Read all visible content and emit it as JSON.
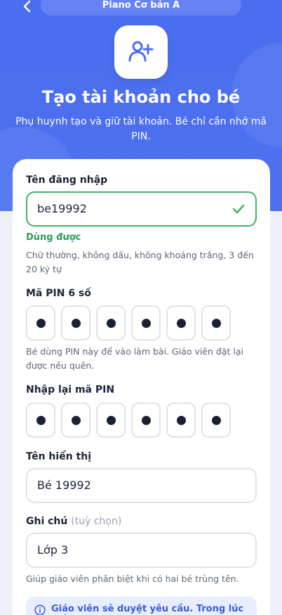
{
  "header": {
    "title": "Piano Cơ bản A",
    "heading": "Tạo tài khoản cho bé",
    "subheading": "Phụ huynh tạo và giữ tài khoản. Bé chỉ cần nhớ mã PIN."
  },
  "username": {
    "label": "Tên đăng nhập",
    "value": "be19992",
    "status": "Dùng được",
    "hint": "Chữ thường, không dấu, không khoảng trắng, 3 đến 20 ký tự"
  },
  "pin": {
    "label": "Mã PIN 6 số",
    "hint": "Bé dùng PIN này để vào làm bài. Giáo viên đặt lại được nếu quên."
  },
  "pin_confirm": {
    "label": "Nhập lại mã PIN"
  },
  "display_name": {
    "label": "Tên hiển thị",
    "value": "Bé 19992"
  },
  "note": {
    "label": "Ghi chú",
    "optional": "(tuỳ chọn)",
    "value": "Lớp 3",
    "hint": "Giúp giáo viên phân biệt khi có hai bé trùng tên."
  },
  "info_banner": {
    "text": "Giáo viên sẽ duyệt yêu cầu. Trong lúc chờ,"
  },
  "colors": {
    "primary": "#4a6ef0",
    "success": "#3fb36a",
    "text": "#1d2338"
  },
  "icons": [
    "chevron-left-icon",
    "user-plus-icon",
    "check-icon",
    "info-icon"
  ]
}
